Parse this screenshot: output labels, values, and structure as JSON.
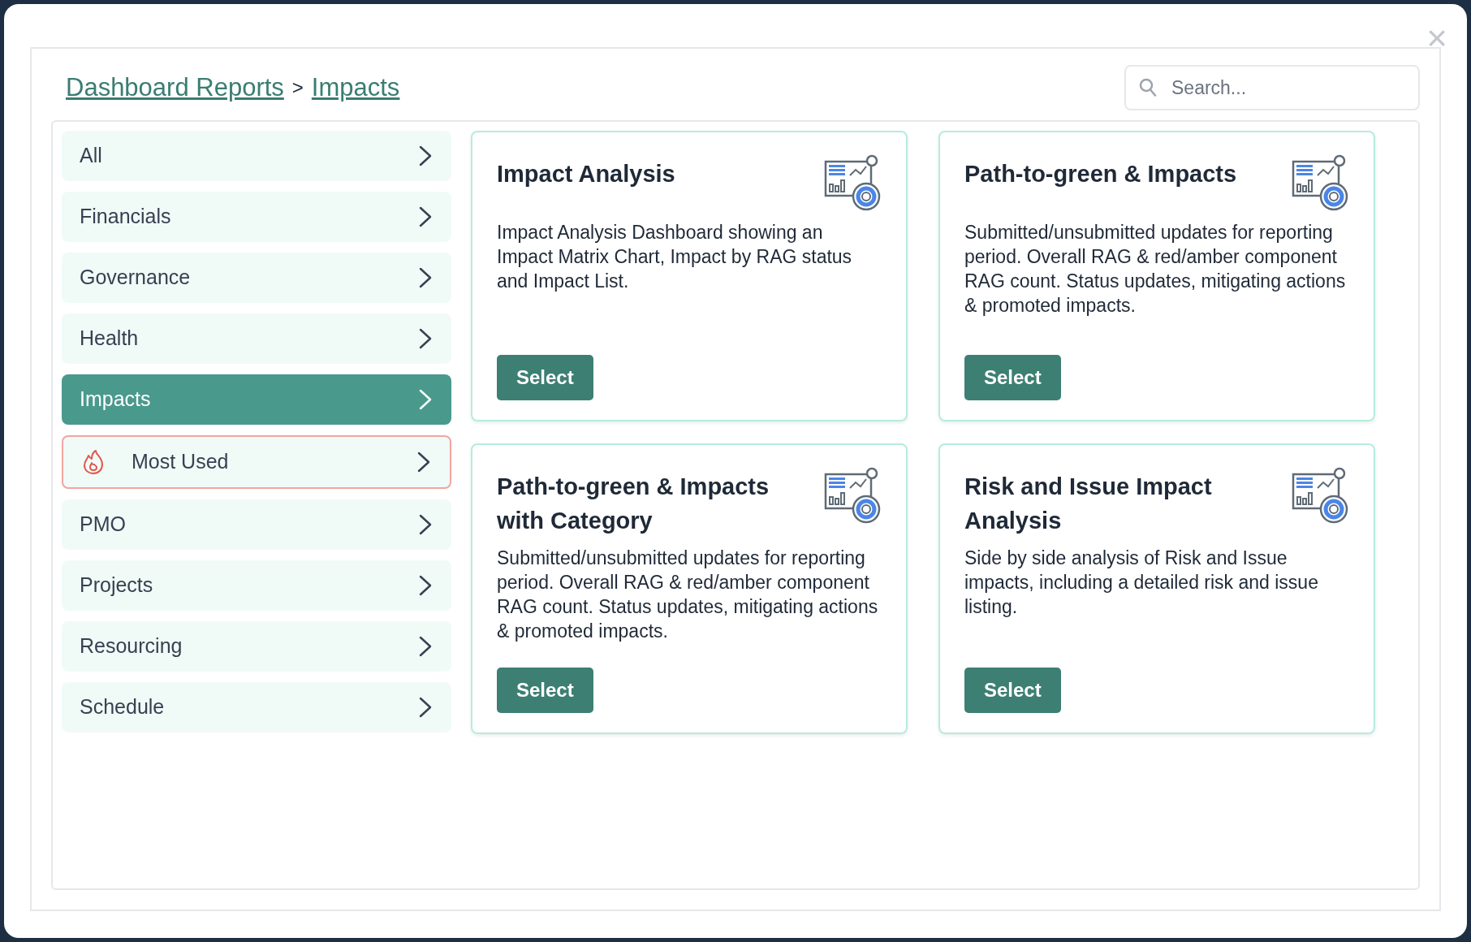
{
  "close_button": "×",
  "breadcrumb": [
    {
      "label": "Dashboard Reports"
    },
    {
      "label": "Impacts"
    }
  ],
  "breadcrumb_separator": ">",
  "search": {
    "placeholder": "Search..."
  },
  "sidebar": {
    "items": [
      {
        "label": "All",
        "kind": "category",
        "selected": false
      },
      {
        "label": "Financials",
        "kind": "category",
        "selected": false
      },
      {
        "label": "Governance",
        "kind": "category",
        "selected": false
      },
      {
        "label": "Health",
        "kind": "category",
        "selected": false
      },
      {
        "label": "Impacts",
        "kind": "category",
        "selected": true
      },
      {
        "label": "Most Used",
        "kind": "featured",
        "selected": false
      },
      {
        "label": "PMO",
        "kind": "category",
        "selected": false
      },
      {
        "label": "Projects",
        "kind": "category",
        "selected": false
      },
      {
        "label": "Resourcing",
        "kind": "category",
        "selected": false
      },
      {
        "label": "Schedule",
        "kind": "category",
        "selected": false
      }
    ]
  },
  "reports": [
    {
      "title": "Impact Analysis",
      "description": "Impact Analysis Dashboard showing an Impact Matrix Chart, Impact by RAG status and Impact List.",
      "button": "Select"
    },
    {
      "title": "Path-to-green & Impacts",
      "description": "Submitted/unsubmitted updates for reporting period. Overall RAG & red/amber component RAG count. Status updates, mitigating actions & promoted impacts.",
      "button": "Select"
    },
    {
      "title": "Path-to-green & Impacts with Category",
      "description": "Submitted/unsubmitted updates for reporting period. Overall RAG & red/amber component RAG count. Status updates, mitigating actions & promoted impacts.",
      "button": "Select"
    },
    {
      "title": "Risk and Issue Impact Analysis",
      "description": "Side by side analysis of Risk and Issue impacts, including a detailed risk and issue listing.",
      "button": "Select"
    }
  ]
}
